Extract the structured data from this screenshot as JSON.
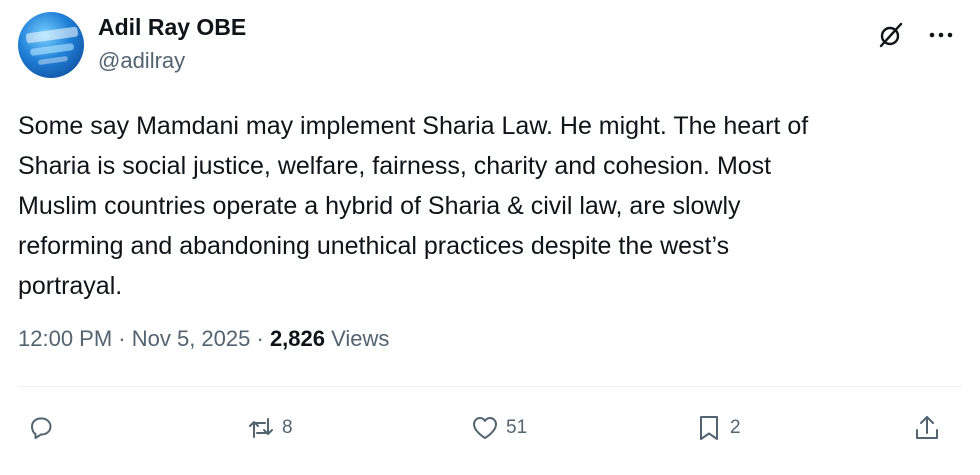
{
  "author": {
    "name": "Adil Ray OBE",
    "handle": "@adilray"
  },
  "icons": {
    "avatar": "profile-avatar",
    "grok": "grok-icon",
    "more": "more-dots-icon",
    "reply": "reply-icon",
    "retweet": "retweet-icon",
    "like": "heart-icon",
    "bookmark": "bookmark-icon",
    "share": "share-icon"
  },
  "tweet": {
    "text": "Some say Mamdani may implement Sharia Law. He might. The heart of\nSharia is social justice, welfare, fairness, charity and cohesion. Most\nMuslim countries operate a hybrid of Sharia & civil law, are slowly\nreforming and abandoning unethical practices despite the west’s\nportrayal.",
    "time": "12:00 PM",
    "date": "Nov 5, 2025",
    "separator": " · ",
    "views_count": "2,826",
    "views_label": "Views"
  },
  "actions": {
    "retweets": "8",
    "likes": "51",
    "bookmarks": "2"
  },
  "colors": {
    "text": "#0f1419",
    "secondary": "#536471",
    "divider": "#eff3f4"
  }
}
